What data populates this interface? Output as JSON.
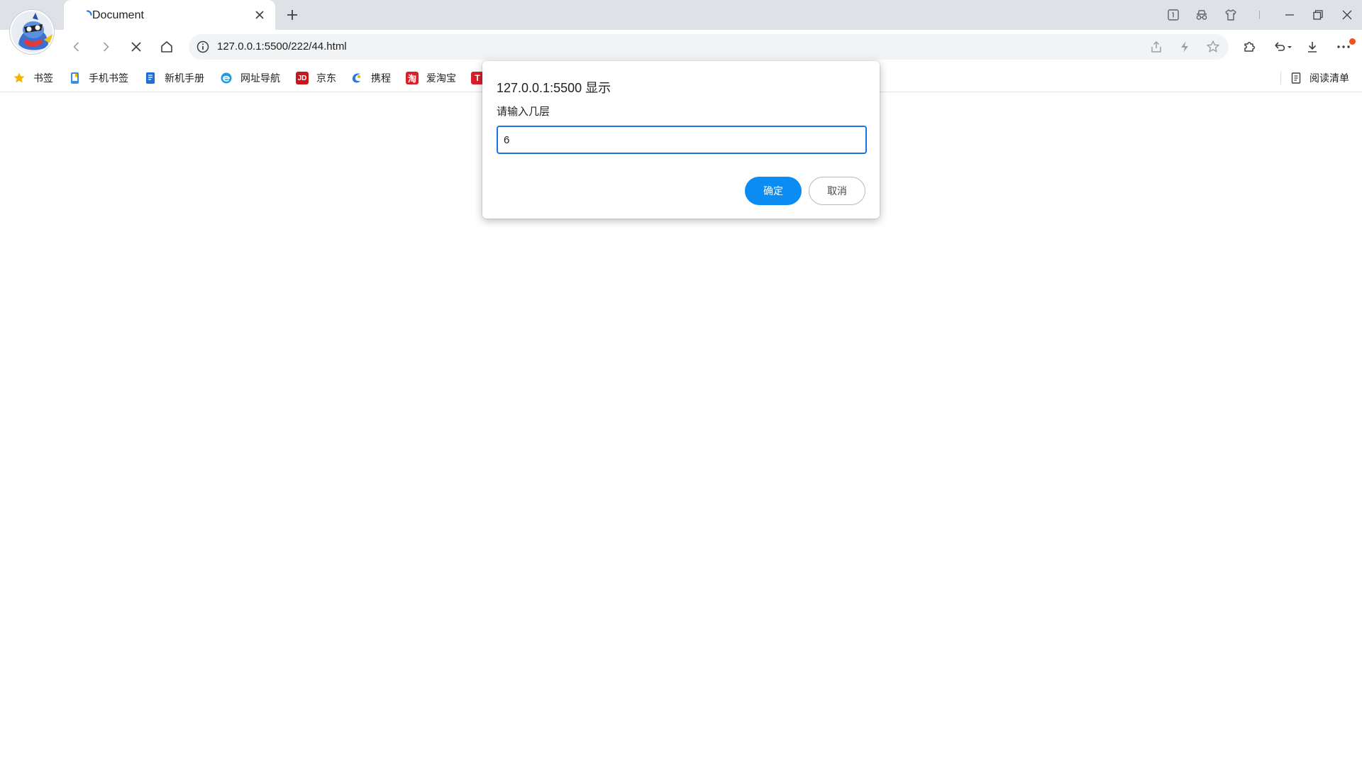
{
  "tab": {
    "title": "Document"
  },
  "toolbar": {
    "url": "127.0.0.1:5500/222/44.html"
  },
  "bookmarks": [
    {
      "label": "书签",
      "icon": "star-icon",
      "color": "#f4b400"
    },
    {
      "label": "手机书签",
      "icon": "phone-icon",
      "color": "#3c8ce7"
    },
    {
      "label": "新机手册",
      "icon": "manual-icon",
      "color": "#1e6fd9"
    },
    {
      "label": "网址导航",
      "icon": "ie-icon",
      "color": "#1a9be6"
    },
    {
      "label": "京东",
      "icon": "jd-icon",
      "color": "#c8161d",
      "glyph": "JD"
    },
    {
      "label": "携程",
      "icon": "ctrip-icon",
      "color": "#2577e3"
    },
    {
      "label": "爱淘宝",
      "icon": "taobao-icon",
      "color": "#d7202c",
      "glyph": "淘"
    },
    {
      "label": "",
      "icon": "tmall-icon",
      "color": "#d7202c",
      "glyph": "T"
    }
  ],
  "reading_list": {
    "label": "阅读清单"
  },
  "dialog": {
    "title": "127.0.0.1:5500 显示",
    "message": "请输入几层",
    "input_value": "6",
    "ok_label": "确定",
    "cancel_label": "取消"
  },
  "colors": {
    "accent": "#0b8cf2",
    "focus": "#1a73e8",
    "notify": "#f25022"
  }
}
